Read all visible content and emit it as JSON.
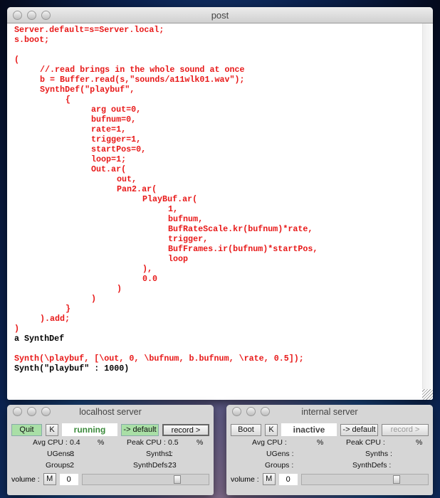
{
  "post": {
    "title": "post",
    "lines": [
      {
        "indent": 0,
        "text": "Server.default=s=Server.local;",
        "color": "#e81818"
      },
      {
        "indent": 0,
        "text": "s.boot;",
        "color": "#e81818"
      },
      {
        "indent": 0,
        "text": "",
        "color": "#e81818"
      },
      {
        "indent": 0,
        "text": "(",
        "color": "#e81818"
      },
      {
        "indent": 1,
        "text": "//.read brings in the whole sound at once",
        "color": "#e81818"
      },
      {
        "indent": 1,
        "text": "b = Buffer.read(s,\"sounds/a11wlk01.wav\");",
        "color": "#e81818"
      },
      {
        "indent": 1,
        "text": "SynthDef(\"playbuf\",",
        "color": "#e81818"
      },
      {
        "indent": 2,
        "text": "{",
        "color": "#e81818"
      },
      {
        "indent": 3,
        "text": "arg out=0,",
        "color": "#e81818"
      },
      {
        "indent": 3,
        "text": "bufnum=0,",
        "color": "#e81818"
      },
      {
        "indent": 3,
        "text": "rate=1,",
        "color": "#e81818"
      },
      {
        "indent": 3,
        "text": "trigger=1,",
        "color": "#e81818"
      },
      {
        "indent": 3,
        "text": "startPos=0,",
        "color": "#e81818"
      },
      {
        "indent": 3,
        "text": "loop=1;",
        "color": "#e81818"
      },
      {
        "indent": 3,
        "text": "Out.ar(",
        "color": "#e81818"
      },
      {
        "indent": 4,
        "text": "out,",
        "color": "#e81818"
      },
      {
        "indent": 4,
        "text": "Pan2.ar(",
        "color": "#e81818"
      },
      {
        "indent": 5,
        "text": "PlayBuf.ar(",
        "color": "#e81818"
      },
      {
        "indent": 6,
        "text": "1,",
        "color": "#e81818"
      },
      {
        "indent": 6,
        "text": "bufnum,",
        "color": "#e81818"
      },
      {
        "indent": 6,
        "text": "BufRateScale.kr(bufnum)*rate,",
        "color": "#e81818"
      },
      {
        "indent": 6,
        "text": "trigger,",
        "color": "#e81818"
      },
      {
        "indent": 6,
        "text": "BufFrames.ir(bufnum)*startPos,",
        "color": "#e81818"
      },
      {
        "indent": 6,
        "text": "loop",
        "color": "#e81818"
      },
      {
        "indent": 5,
        "text": "),",
        "color": "#e81818"
      },
      {
        "indent": 5,
        "text": "0.0",
        "color": "#e81818"
      },
      {
        "indent": 4,
        "text": ")",
        "color": "#e81818"
      },
      {
        "indent": 3,
        "text": ")",
        "color": "#e81818"
      },
      {
        "indent": 2,
        "text": "}",
        "color": "#e81818"
      },
      {
        "indent": 1,
        "text": ").add;",
        "color": "#e81818"
      },
      {
        "indent": 0,
        "text": ")",
        "color": "#e81818"
      },
      {
        "indent": 0,
        "text": "a SynthDef",
        "color": "#000000"
      },
      {
        "indent": 0,
        "text": "",
        "color": "#000000"
      },
      {
        "indent": 0,
        "text": "Synth(\\playbuf, [\\out, 0, \\bufnum, b.bufnum, \\rate, 0.5]);",
        "color": "#e81818"
      },
      {
        "indent": 0,
        "text": "Synth(\"playbuf\" : 1000)",
        "color": "#000000"
      }
    ]
  },
  "local": {
    "title": "localhost server",
    "boot": "Quit",
    "kill": "K",
    "status": "running",
    "status_color": "#3a8a3a",
    "default": "-> default",
    "record": "record >",
    "avg_cpu_label": "Avg CPU :",
    "avg_cpu": "0.4",
    "pct": "%",
    "peak_cpu_label": "Peak CPU :",
    "peak_cpu": "0.5",
    "ugens_label": "UGens :",
    "ugens": "8",
    "synths_label": "Synths :",
    "synths": "1",
    "groups_label": "Groups :",
    "groups": "2",
    "synthdefs_label": "SynthDefs :",
    "synthdefs": "23",
    "volume_label": "volume :",
    "mute": "M",
    "volume": "0",
    "volume_fraction": 0.75
  },
  "internal": {
    "title": "internal server",
    "boot": "Boot",
    "kill": "K",
    "status": "inactive",
    "status_color": "#444444",
    "default": "-> default",
    "record": "record >",
    "avg_cpu_label": "Avg CPU :",
    "pct": "%",
    "peak_cpu_label": "Peak CPU :",
    "ugens_label": "UGens :",
    "synths_label": "Synths :",
    "groups_label": "Groups :",
    "synthdefs_label": "SynthDefs :",
    "volume_label": "volume :",
    "mute": "M",
    "volume": "0",
    "volume_fraction": 0.75
  }
}
